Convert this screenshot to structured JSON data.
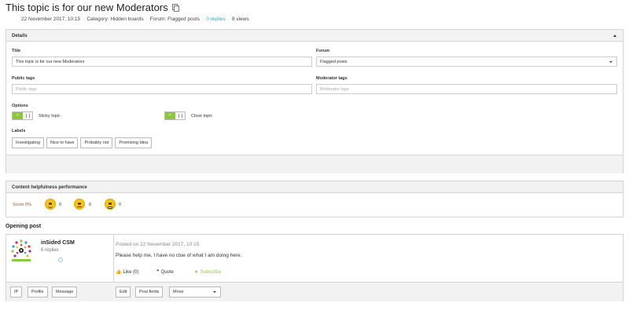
{
  "topic": {
    "title": "This topic is for our new Moderators",
    "date": "22 November 2017, 10:15",
    "category": "Category: Hidden boards",
    "forum": "Forum: Flagged posts",
    "replies": "0 replies",
    "views": "8 views"
  },
  "details": {
    "heading": "Details",
    "title_label": "Title",
    "title_value": "This topic is for our new Moderators",
    "forum_label": "Forum",
    "forum_value": "Flagged posts",
    "public_tags_label": "Public tags",
    "public_tags_placeholder": "Public tags",
    "moderator_tags_label": "Moderator tags",
    "moderator_tags_placeholder": "Moderator tags",
    "options_label": "Options",
    "sticky_label": "Sticky topic",
    "close_label": "Close topic",
    "labels_label": "Labels",
    "labels": [
      "Investigating",
      "Nice to have",
      "Probably not",
      "Promising Idea"
    ]
  },
  "performance": {
    "heading": "Content helpfulness performance",
    "score": "Score 0%",
    "happy_count": "0",
    "neutral_count": "0",
    "sad_count": "0"
  },
  "opening_post": {
    "heading": "Opening post",
    "author": "inSided CSM",
    "author_replies": "6 replies",
    "posted": "Posted on 22 November 2017, 10:15",
    "body": "Please help me, I have no clue of what I am doing here.",
    "like": "Like (0)",
    "quote": "Quote",
    "subscribe": "Subscribe",
    "buttons": {
      "ip": "IP",
      "profile": "Profile",
      "message": "Message",
      "edit": "Edit",
      "post_fields": "Post fields",
      "move": "Move"
    }
  },
  "colors": {
    "accent_link": "#2aa5c8",
    "toggle_on": "#8dc63f",
    "score": "#a0522d"
  }
}
